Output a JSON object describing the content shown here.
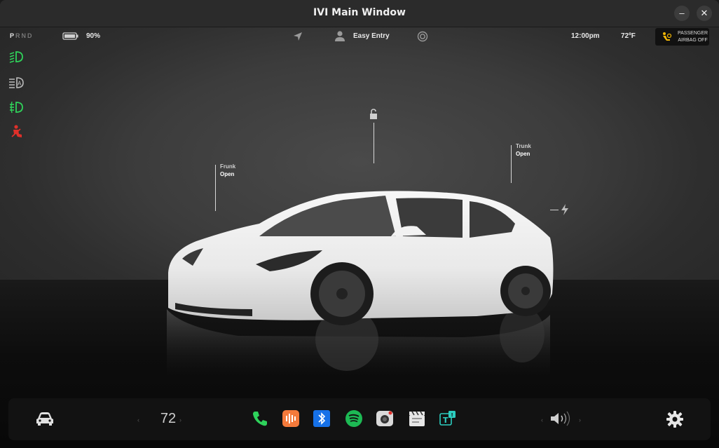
{
  "window": {
    "title": "IVI Main Window",
    "minimize_symbol": "–",
    "close_symbol": "✕"
  },
  "status_bar": {
    "gears": [
      "P",
      "R",
      "N",
      "D"
    ],
    "active_gear": "P",
    "battery_percent": "90%",
    "profile_label": "Easy Entry",
    "time": "12:00pm",
    "temperature": "72ºF",
    "airbag_line1": "PASSENGER",
    "airbag_line2": "AIRBAG OFF"
  },
  "indicators": [
    "low-beam-icon",
    "auto-headlight-icon",
    "fog-light-icon",
    "seatbelt-warning-icon"
  ],
  "vehicle": {
    "frunk_label": "Frunk",
    "frunk_status": "Open",
    "trunk_label": "Trunk",
    "trunk_status": "Open"
  },
  "dock": {
    "cabin_temperature": "72",
    "apps": [
      "phone-icon",
      "podcast-icon",
      "bluetooth-icon",
      "spotify-icon",
      "camera-icon",
      "theater-icon",
      "toybox-icon"
    ]
  },
  "colors": {
    "indicator_green": "#2fd35a",
    "warning_red": "#e0302a",
    "airbag_yellow": "#f2b705",
    "phone_green": "#2ed25b",
    "bluetooth_blue": "#1671e8",
    "spotify_green": "#1db954"
  }
}
